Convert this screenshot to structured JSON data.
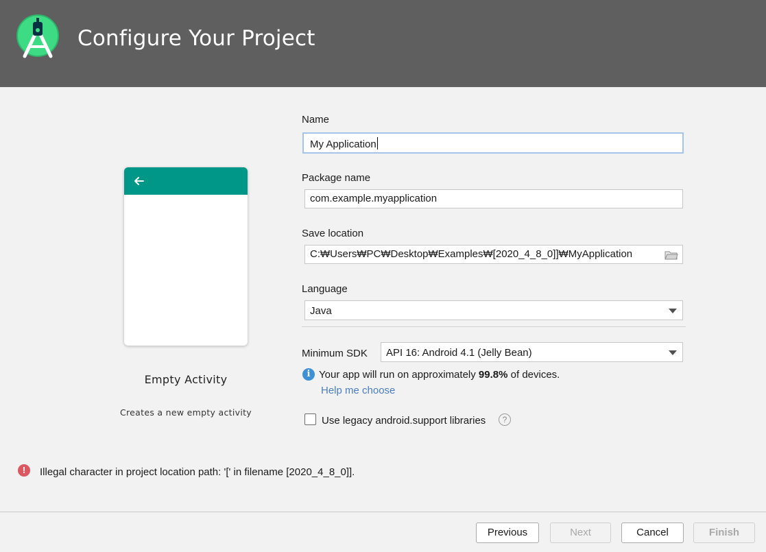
{
  "header": {
    "title": "Configure Your Project",
    "logo_icon": "android-studio-icon"
  },
  "preview": {
    "activity_name": "Empty Activity",
    "activity_description": "Creates a new empty activity",
    "accent_color": "#009688"
  },
  "form": {
    "name": {
      "label": "Name",
      "value": "My Application"
    },
    "package_name": {
      "label": "Package name",
      "value": "com.example.myapplication"
    },
    "save_location": {
      "label": "Save location",
      "value": "C:₩Users₩PC₩Desktop₩Examples₩[2020_4_8_0]]₩MyApplication"
    },
    "language": {
      "label": "Language",
      "selected": "Java"
    },
    "minimum_sdk": {
      "label": "Minimum SDK",
      "selected": "API 16: Android 4.1 (Jelly Bean)"
    },
    "info": {
      "prefix": "Your app will run on approximately ",
      "percent": "99.8%",
      "suffix": " of devices.",
      "help_link": "Help me choose"
    },
    "legacy": {
      "label": "Use legacy android.support libraries",
      "checked": false
    }
  },
  "error": {
    "message": "Illegal character in project location path: '[' in filename [2020_4_8_0]]."
  },
  "buttons": {
    "previous": "Previous",
    "next": "Next",
    "cancel": "Cancel",
    "finish": "Finish"
  }
}
